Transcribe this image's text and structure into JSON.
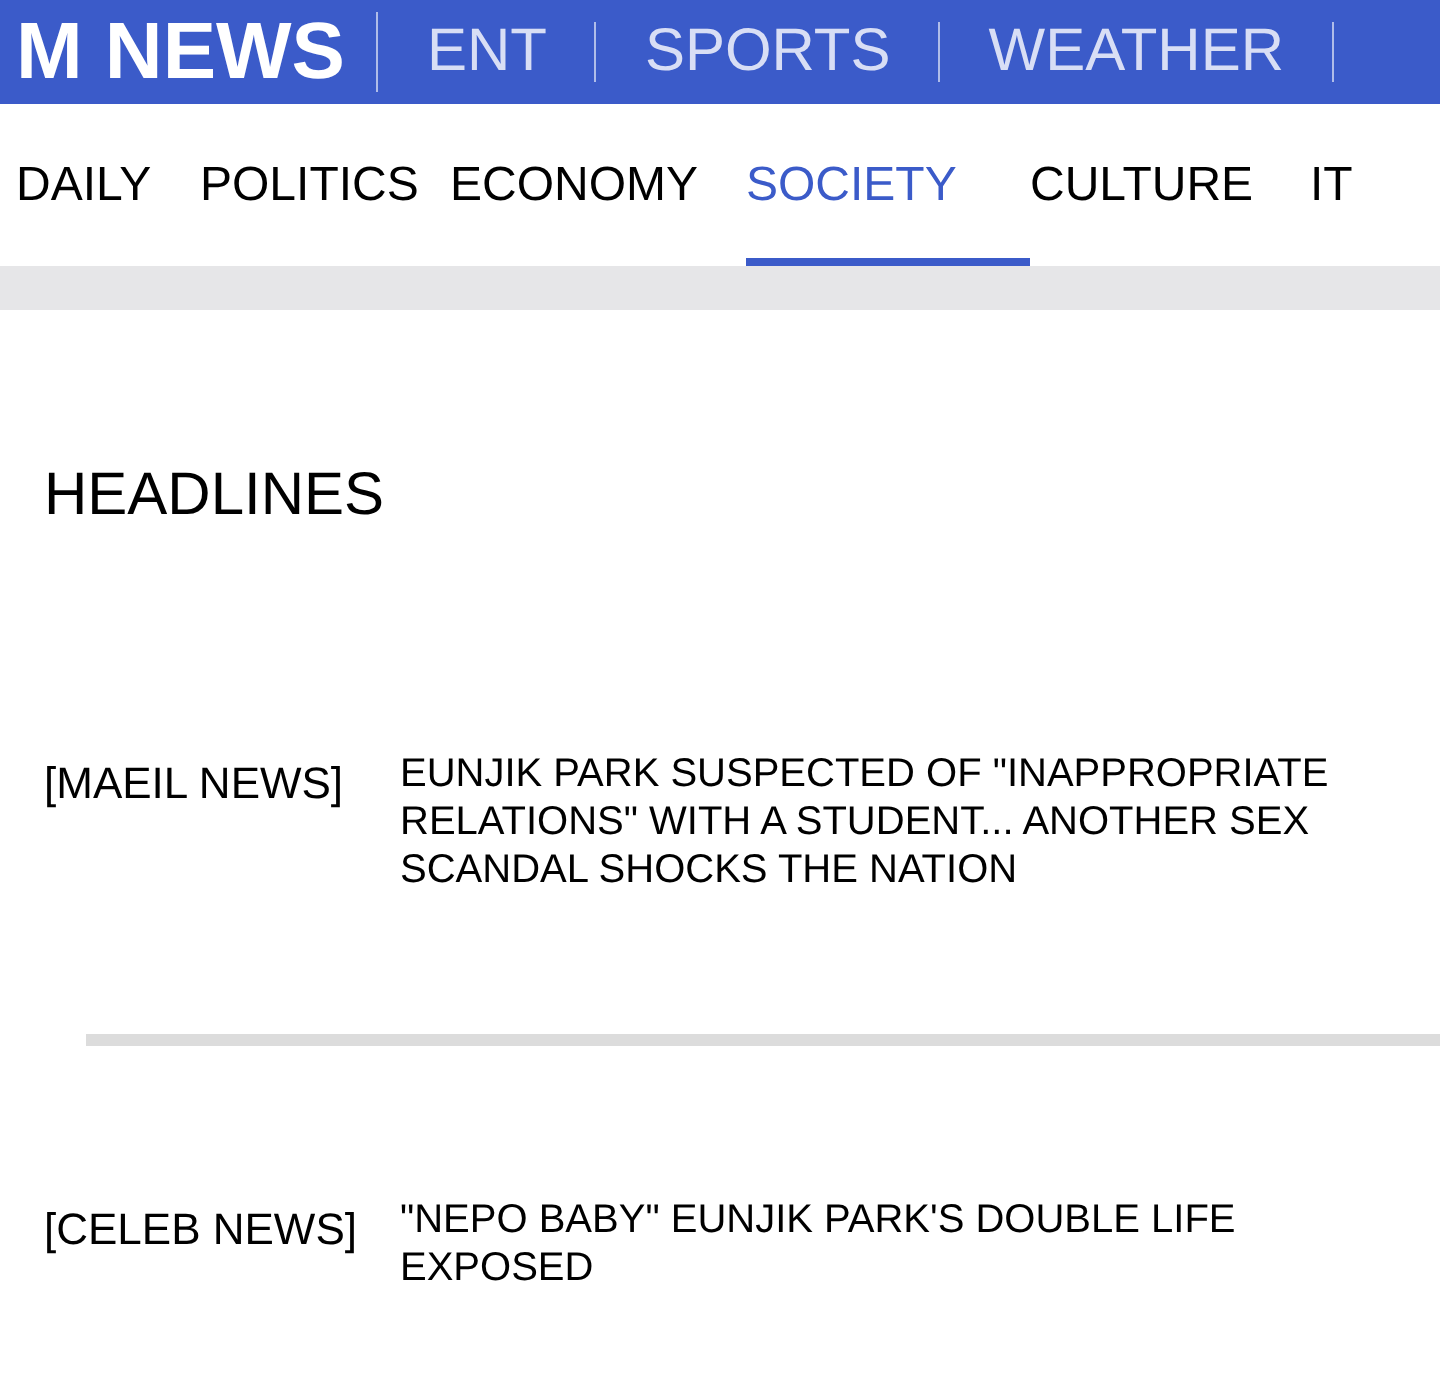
{
  "header": {
    "logo": "M NEWS",
    "sections": [
      "ENT",
      "SPORTS",
      "WEATHER"
    ]
  },
  "tabs": [
    {
      "label": "DAILY",
      "selected": false
    },
    {
      "label": "POLITICS",
      "selected": false
    },
    {
      "label": "ECONOMY",
      "selected": false
    },
    {
      "label": "SOCIETY",
      "selected": true
    },
    {
      "label": "CULTURE",
      "selected": false
    },
    {
      "label": "IT",
      "selected": false
    }
  ],
  "section_title": "HEADLINES",
  "articles": [
    {
      "source": "[MAEIL NEWS]",
      "title": "EUNJIK PARK SUSPECTED OF \"INAPPROPRIATE RELATIONS\" WITH A STUDENT... ANOTHER SEX SCANDAL SHOCKS THE NATION"
    },
    {
      "source": "[CELEB NEWS]",
      "title": "\"NEPO BABY\" EUNJIK PARK'S DOUBLE LIFE EXPOSED"
    }
  ]
}
